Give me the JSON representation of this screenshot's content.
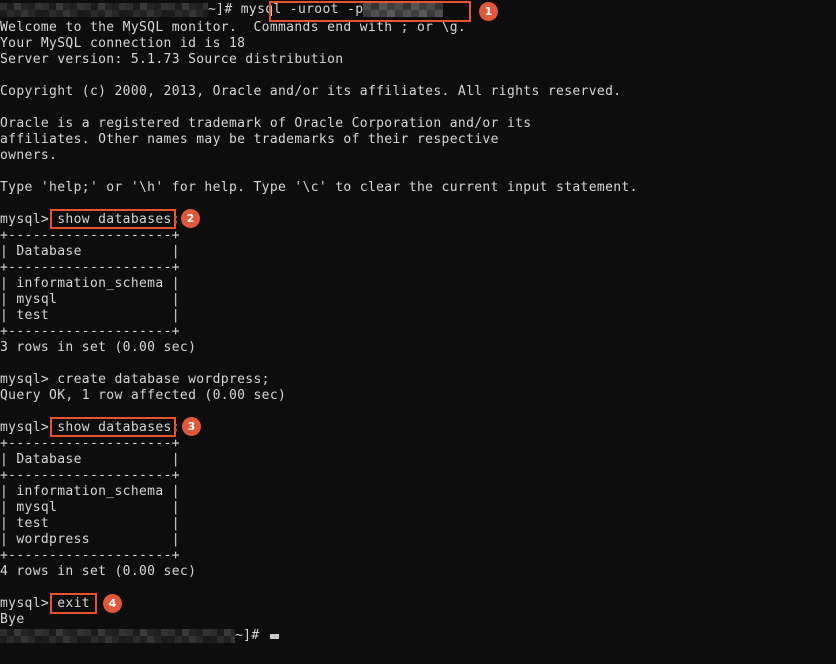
{
  "terminal": {
    "background_color": "#0d0d0d",
    "text_color": "#d6d6d6",
    "accent_color": "#e8532f",
    "badge_color": "#e05739",
    "lines": {
      "l01_prompt_tail": "~]# ",
      "l01_command": "mysql -uroot -p",
      "l02": "Welcome to the MySQL monitor.  Commands end with ; or \\g.",
      "l03": "Your MySQL connection id is 18",
      "l04": "Server version: 5.1.73 Source distribution",
      "l06": "Copyright (c) 2000, 2013, Oracle and/or its affiliates. All rights reserved.",
      "l08": "Oracle is a registered trademark of Oracle Corporation and/or its",
      "l09": "affiliates. Other names may be trademarks of their respective",
      "l10": "owners.",
      "l12": "Type 'help;' or '\\h' for help. Type '\\c' to clear the current input statement.",
      "l14_prompt": "mysql> ",
      "l14_command": "show databases;",
      "l15": "+--------------------+",
      "l16": "| Database           |",
      "l17": "+--------------------+",
      "l18": "| information_schema |",
      "l19": "| mysql              |",
      "l20": "| test               |",
      "l21": "+--------------------+",
      "l22": "3 rows in set (0.00 sec)",
      "l24": "mysql> create database wordpress;",
      "l25": "Query OK, 1 row affected (0.00 sec)",
      "l27_prompt": "mysql> ",
      "l27_command": "show databases;",
      "l28": "+--------------------+",
      "l29": "| Database           |",
      "l30": "+--------------------+",
      "l31": "| information_schema |",
      "l32": "| mysql              |",
      "l33": "| test               |",
      "l34": "| wordpress          |",
      "l35": "+--------------------+",
      "l36": "4 rows in set (0.00 sec)",
      "l38_prompt": "mysql> ",
      "l38_command": "exit",
      "l39": "Bye",
      "l40_prompt_tail": "~]# "
    }
  },
  "annotations": {
    "badges": [
      {
        "number": "1"
      },
      {
        "number": "2"
      },
      {
        "number": "3"
      },
      {
        "number": "4"
      }
    ]
  }
}
